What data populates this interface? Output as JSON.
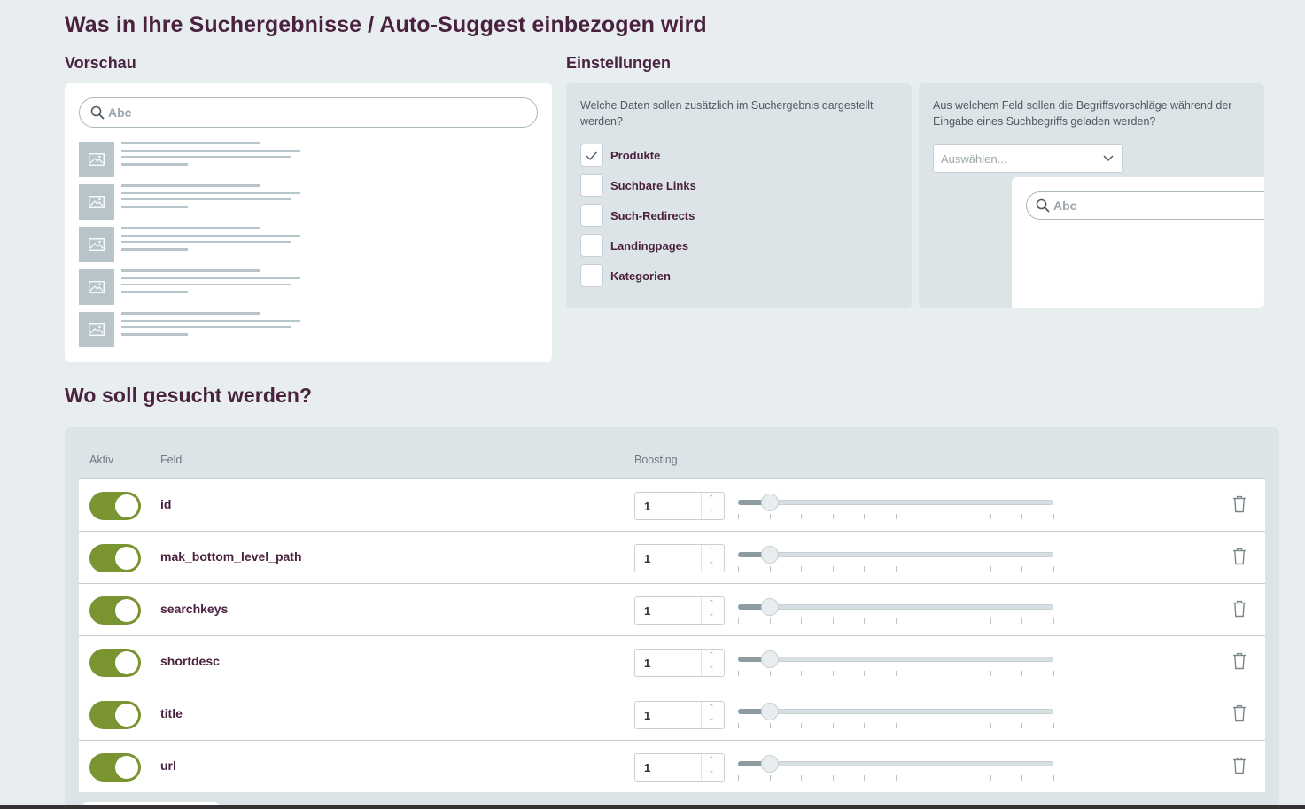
{
  "page": {
    "title": "Was in Ihre Suchergebnisse / Auto-Suggest einbezogen wird",
    "section2_title": "Wo soll gesucht werden?"
  },
  "preview": {
    "heading": "Vorschau",
    "search_placeholder": "Abc",
    "result_count": 5
  },
  "settings": {
    "heading": "Einstellungen",
    "data_question": "Welche Daten sollen zusätzlich im Suchergebnis dargestellt werden?",
    "options": [
      {
        "label": "Produkte",
        "checked": true
      },
      {
        "label": "Suchbare Links",
        "checked": false
      },
      {
        "label": "Such-Redirects",
        "checked": false
      },
      {
        "label": "Landingpages",
        "checked": false
      },
      {
        "label": "Kategorien",
        "checked": false
      }
    ],
    "field_question": "Aus welchem Feld sollen die Begriffsvorschläge während der Eingabe eines Suchbegriffs geladen werden?",
    "select_placeholder": "Auswählen...",
    "suggest_placeholder": "Abc"
  },
  "table": {
    "headers": {
      "active": "Aktiv",
      "field": "Feld",
      "boosting": "Boosting"
    },
    "rows": [
      {
        "field": "id",
        "active": true,
        "boost": "1"
      },
      {
        "field": "mak_bottom_level_path",
        "active": true,
        "boost": "1"
      },
      {
        "field": "searchkeys",
        "active": true,
        "boost": "1"
      },
      {
        "field": "shortdesc",
        "active": true,
        "boost": "1"
      },
      {
        "field": "title",
        "active": true,
        "boost": "1"
      },
      {
        "field": "url",
        "active": true,
        "boost": "1"
      }
    ],
    "slider_min": 0,
    "slider_max": 10,
    "slider_value": 1
  },
  "colors": {
    "title": "#4a2240",
    "toggle_on": "#7a9431",
    "panel_grey": "#dde4e7",
    "background": "#e8eef0"
  },
  "icons": {
    "search": "search-icon",
    "image": "image-placeholder-icon",
    "check": "check-icon",
    "chevron": "chevron-down-icon",
    "trash": "trash-icon"
  }
}
